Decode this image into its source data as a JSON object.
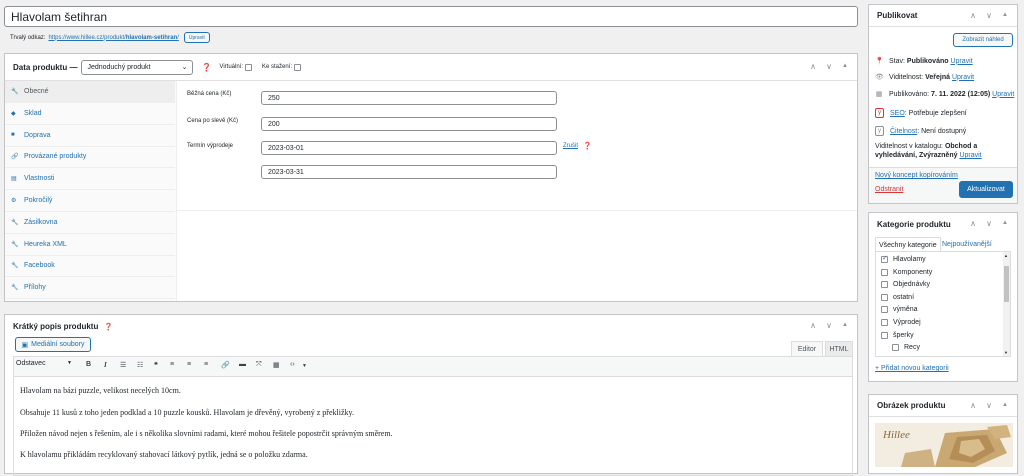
{
  "title": {
    "value": "Hlavolam šetihran"
  },
  "permalink": {
    "label": "Trvalý odkaz:",
    "url_prefix": "https://www.hillee.cz/produkt/",
    "slug": "hlavolam-setihran",
    "url_suffix": "/",
    "edit_button": "Upravit"
  },
  "product_data": {
    "heading": "Data produktu —",
    "type_value": "Jednoduchý produkt",
    "virtual_label": "Virtuální:",
    "download_label": "Ke stažení:",
    "tabs": [
      {
        "label": "Obecné",
        "icon": "wrench-icon"
      },
      {
        "label": "Sklad",
        "icon": "tag-icon"
      },
      {
        "label": "Doprava",
        "icon": "truck-icon"
      },
      {
        "label": "Provázané produkty",
        "icon": "link-icon"
      },
      {
        "label": "Vlastnosti",
        "icon": "list-icon"
      },
      {
        "label": "Pokročilý",
        "icon": "gear-icon"
      },
      {
        "label": "Zásilkovna",
        "icon": "wrench-icon"
      },
      {
        "label": "Heureka XML",
        "icon": "wrench-icon"
      },
      {
        "label": "Facebook",
        "icon": "wrench-icon"
      },
      {
        "label": "Přílohy",
        "icon": "wrench-icon"
      }
    ],
    "regular_price_label": "Běžná cena (Kč)",
    "regular_price": "250",
    "sale_price_label": "Cena po slevě (Kč)",
    "sale_price": "200",
    "sale_dates_label": "Termín výprodeje",
    "sale_from": "2023-03-01",
    "sale_to": "2023-03-31",
    "cancel_link": "Zrušit"
  },
  "short_desc": {
    "heading": "Krátký popis produktu",
    "media_button": "Mediální soubory",
    "format_select": "Odstavec",
    "tab_editor": "Editor",
    "tab_html": "HTML",
    "paragraphs": [
      "Hlavolam na bázi puzzle, velikost necelých 10cm.",
      "Obsahuje 11 kusů z toho jeden podklad a 10 puzzle kousků. Hlavolam je dřevěný, vyrobený z překližky.",
      "Přiložen návod nejen s řešením, ale i s několika slovními radami, které mohou řešitele popostrčit správným směrem.",
      "K hlavolamu přikládám recyklovaný stahovací látkový pytlík, jedná se o položku zdarma."
    ]
  },
  "publish": {
    "heading": "Publikovat",
    "preview_button": "Zobrazit náhled",
    "status_label": "Stav:",
    "status_value": "Publikováno",
    "status_edit": "Upravit",
    "visibility_label": "Viditelnost:",
    "visibility_value": "Veřejná",
    "visibility_edit": "Upravit",
    "published_label": "Publikováno:",
    "published_value": "7. 11. 2022 (12:05)",
    "published_edit": "Upravit",
    "seo_label": "SEO",
    "seo_value": ": Potřebuje zlepšení",
    "readability_label": "Čitelnost",
    "readability_value": ": Není dostupný",
    "catalog_label": "Viditelnost v katalogu:",
    "catalog_value_1": "Obchod a",
    "catalog_value_2": "vyhledávání, Zvýrazněný",
    "catalog_edit": "Upravit",
    "copy_link": "Nový koncept kopírováním",
    "trash_link": "Odstranit",
    "update_button": "Aktualizovat"
  },
  "categories": {
    "heading": "Kategorie produktu",
    "tab_all": "Všechny kategorie",
    "tab_popular": "Nejpoužívanější",
    "items": [
      {
        "label": "Hlavolamy",
        "checked": true
      },
      {
        "label": "Komponenty",
        "checked": false
      },
      {
        "label": "Objednávky",
        "checked": false
      },
      {
        "label": "ostatní",
        "checked": false
      },
      {
        "label": "výměna",
        "checked": false
      },
      {
        "label": "Výprodej",
        "checked": false
      },
      {
        "label": "šperky",
        "checked": false
      },
      {
        "label": "Recy",
        "checked": false
      }
    ],
    "add_link": "+ Přidat novou kategorii"
  },
  "image": {
    "heading": "Obrázek produktu",
    "logo_text": "Hillee"
  },
  "colors": {
    "accent": "#2271b1",
    "seo_red": "#d63638",
    "border": "#c3c4c7",
    "bg": "#f0f0f1"
  }
}
